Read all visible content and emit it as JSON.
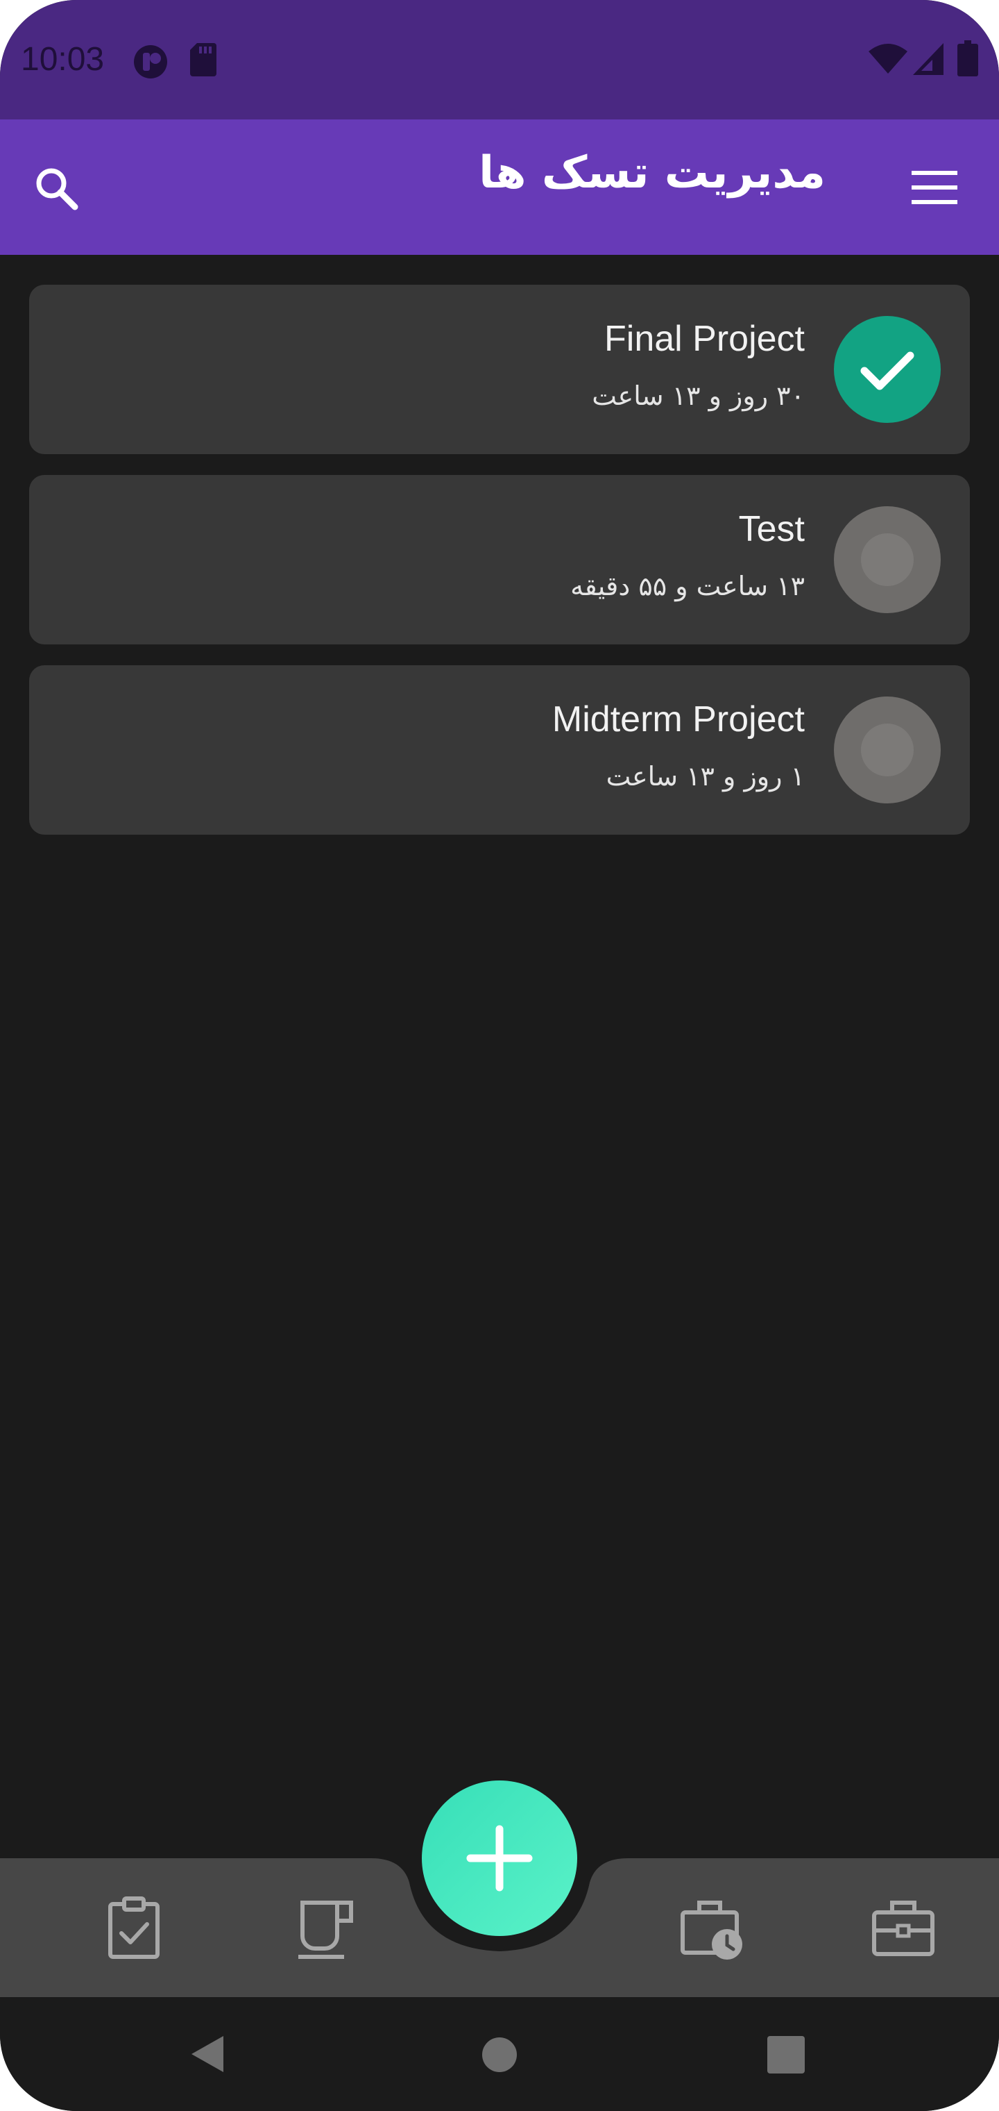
{
  "status_bar": {
    "time": "10:03",
    "icons": [
      "app-notification-icon",
      "sd-card-icon",
      "wifi-icon",
      "cell-signal-icon",
      "battery-icon"
    ]
  },
  "app_bar": {
    "title": "مدیریت تسک ها",
    "search_icon": "search-icon",
    "menu_icon": "hamburger-menu-icon"
  },
  "tasks": [
    {
      "title": "Final Project",
      "remaining": "۳۰ روز و ۱۳ ساعت",
      "completed": true
    },
    {
      "title": "Test",
      "remaining": "۱۳ ساعت و ۵۵ دقیقه",
      "completed": false
    },
    {
      "title": "Midterm Project",
      "remaining": "۱ روز و ۱۳ ساعت",
      "completed": false
    }
  ],
  "bottom_nav": {
    "items": [
      "task-clipboard-icon",
      "coffee-cup-icon",
      "fab-add-icon",
      "briefcase-clock-icon",
      "briefcase-icon"
    ]
  },
  "colors": {
    "status_bar": "#4a2882",
    "app_bar": "#673ab7",
    "background": "#1b1b1b",
    "card": "#383838",
    "done": "#12a383",
    "fab": "#4aeec4"
  }
}
